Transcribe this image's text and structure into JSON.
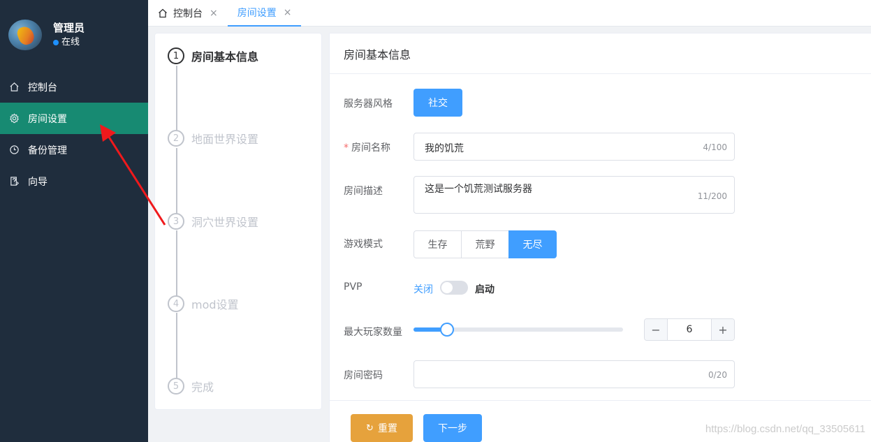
{
  "user": {
    "name": "管理员",
    "status": "在线"
  },
  "sidebar": {
    "items": [
      {
        "label": "控制台",
        "icon": "home-icon"
      },
      {
        "label": "房间设置",
        "icon": "gear-icon",
        "active": true
      },
      {
        "label": "备份管理",
        "icon": "clock-icon"
      },
      {
        "label": "向导",
        "icon": "guide-icon"
      }
    ]
  },
  "tabs": [
    {
      "label": "控制台",
      "close": "×"
    },
    {
      "label": "房间设置",
      "close": "×",
      "active": true
    }
  ],
  "steps": [
    {
      "num": "1",
      "title": "房间基本信息",
      "active": true
    },
    {
      "num": "2",
      "title": "地面世界设置"
    },
    {
      "num": "3",
      "title": "洞穴世界设置"
    },
    {
      "num": "4",
      "title": "mod设置"
    },
    {
      "num": "5",
      "title": "完成"
    }
  ],
  "form": {
    "header": "房间基本信息",
    "server_style": {
      "label": "服务器风格",
      "value": "社交"
    },
    "room_name": {
      "label": "房间名称",
      "required_mark": "*",
      "value": "我的饥荒",
      "count": "4/100"
    },
    "room_desc": {
      "label": "房间描述",
      "value": "这是一个饥荒测试服务器",
      "count": "11/200"
    },
    "game_mode": {
      "label": "游戏模式",
      "options": [
        "生存",
        "荒野",
        "无尽"
      ],
      "selected": "无尽"
    },
    "pvp": {
      "label": "PVP",
      "off_text": "关闭",
      "on_text": "启动",
      "enabled": false
    },
    "max_players": {
      "label": "最大玩家数量",
      "value": "6",
      "minus": "−",
      "plus": "+",
      "slider_min": 1,
      "slider_max": 64,
      "slider_fraction": 0.16
    },
    "room_password": {
      "label": "房间密码",
      "value": "",
      "count": "0/20"
    }
  },
  "footer": {
    "reset_label": "重置",
    "reset_icon": "↻",
    "next_label": "下一步"
  },
  "watermark": "https://blog.csdn.net/qq_33505611",
  "colors": {
    "primary": "#409eff",
    "sidebar_bg": "#1f2d3d",
    "active_menu": "#178a72",
    "reset": "#e6a23c",
    "annotation_arrow": "#f0191c"
  }
}
